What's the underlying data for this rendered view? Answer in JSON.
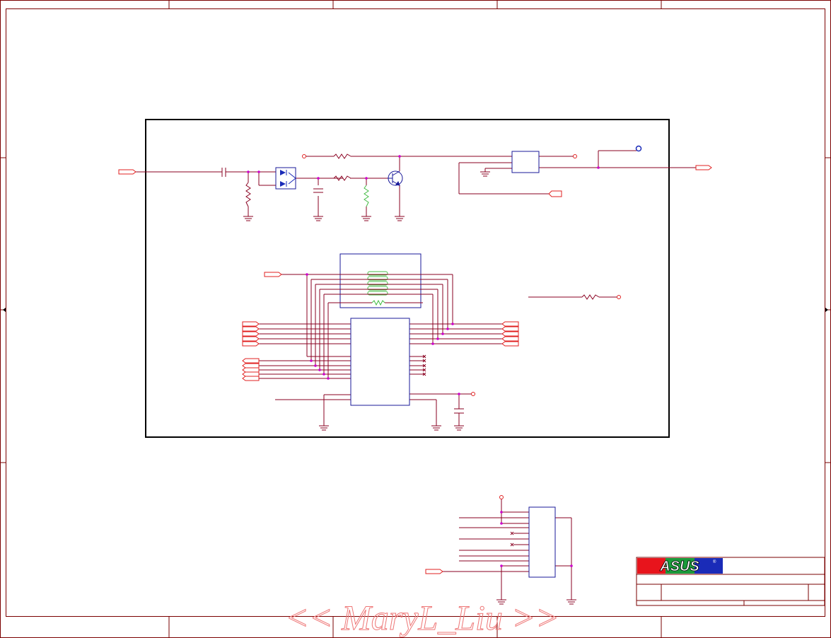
{
  "document": {
    "type": "schematic",
    "watermark": "<< MaryL_Liu >>"
  },
  "title_block": {
    "logo_text": "ASUS",
    "logo_registered": "®",
    "colors": {
      "logo_red": "#e8141c",
      "logo_green": "#1a9a3a",
      "logo_blue": "#1a2bb8"
    }
  },
  "colors": {
    "frame": "#7a0000",
    "wire": "#8a0020",
    "ic_outline": "#1a1a9a",
    "junction": "#cc00cc",
    "port": "#e02020",
    "resistor_alt": "#44bb44",
    "watermark": "#ee7777"
  },
  "icons": {
    "port": "offpage-connector-icon",
    "ground": "ground-icon",
    "resistor": "resistor-icon",
    "capacitor": "capacitor-icon",
    "diode": "diode-icon",
    "transistor": "npn-transistor-icon",
    "no_connect": "no-connect-icon"
  }
}
